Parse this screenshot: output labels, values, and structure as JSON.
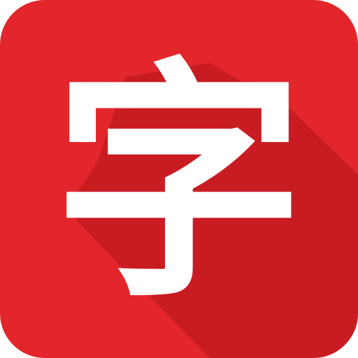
{
  "app_icon": {
    "glyph": "字",
    "colors": {
      "background": "#e2262b",
      "shadow": "#c81c22",
      "glyph": "#ffffff"
    }
  }
}
